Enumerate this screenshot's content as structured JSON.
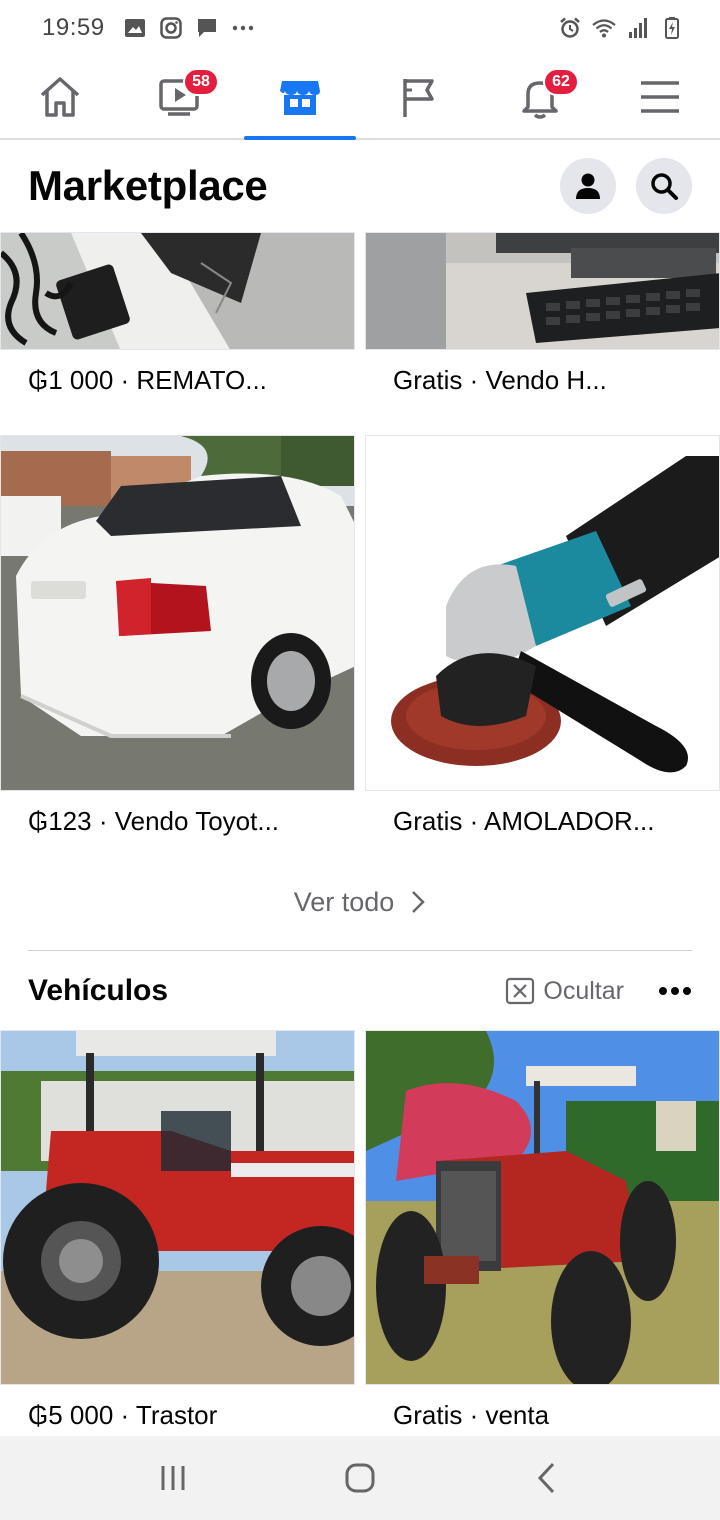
{
  "status_bar": {
    "time": "19:59",
    "left_icons": [
      "gallery-icon",
      "instagram-icon",
      "chat-bubble-icon",
      "more-dots-icon"
    ],
    "right_icons": [
      "alarm-icon",
      "wifi-icon",
      "signal-icon",
      "battery-icon"
    ]
  },
  "nav_tabs": [
    {
      "name": "home",
      "icon": "home-icon",
      "badge": ""
    },
    {
      "name": "watch",
      "icon": "video-icon",
      "badge": "58"
    },
    {
      "name": "marketplace",
      "icon": "marketplace-store-icon",
      "badge": "",
      "active": true
    },
    {
      "name": "pages",
      "icon": "flag-icon",
      "badge": ""
    },
    {
      "name": "notifications",
      "icon": "bell-icon",
      "badge": "62"
    },
    {
      "name": "menu",
      "icon": "hamburger-menu-icon",
      "badge": ""
    }
  ],
  "header": {
    "title": "Marketplace",
    "profile_icon": "person-icon",
    "search_icon": "search-icon"
  },
  "listings_top": [
    {
      "caption": "₲1 000 · REMATO...",
      "image": "laptop charger and cables"
    },
    {
      "caption": "Gratis · Vendo H...",
      "image": "desktop computer keyboard"
    },
    {
      "caption": "₲123 · Vendo Toyot...",
      "image": "white toyota sedan"
    },
    {
      "caption": "Gratis · AMOLADOR...",
      "image": "makita angle grinder"
    }
  ],
  "see_all": {
    "label": "Ver todo",
    "icon": "chevron-right-icon"
  },
  "vehicles_section": {
    "title": "Vehículos",
    "hide_label": "Ocultar",
    "hide_icon": "close-box-icon",
    "more_icon": "more-horizontal-icon",
    "listings": [
      {
        "caption": "₲5 000 · Trastor",
        "image": "red massey ferguson tractor"
      },
      {
        "caption": "Gratis · venta",
        "image": "red tractor in field"
      }
    ]
  },
  "brand_colors": {
    "accent": "#1877f2",
    "badge": "#e41e3f",
    "muted_text": "#65676b"
  },
  "android_nav": [
    "recents-icon",
    "home-circle-icon",
    "back-icon"
  ]
}
